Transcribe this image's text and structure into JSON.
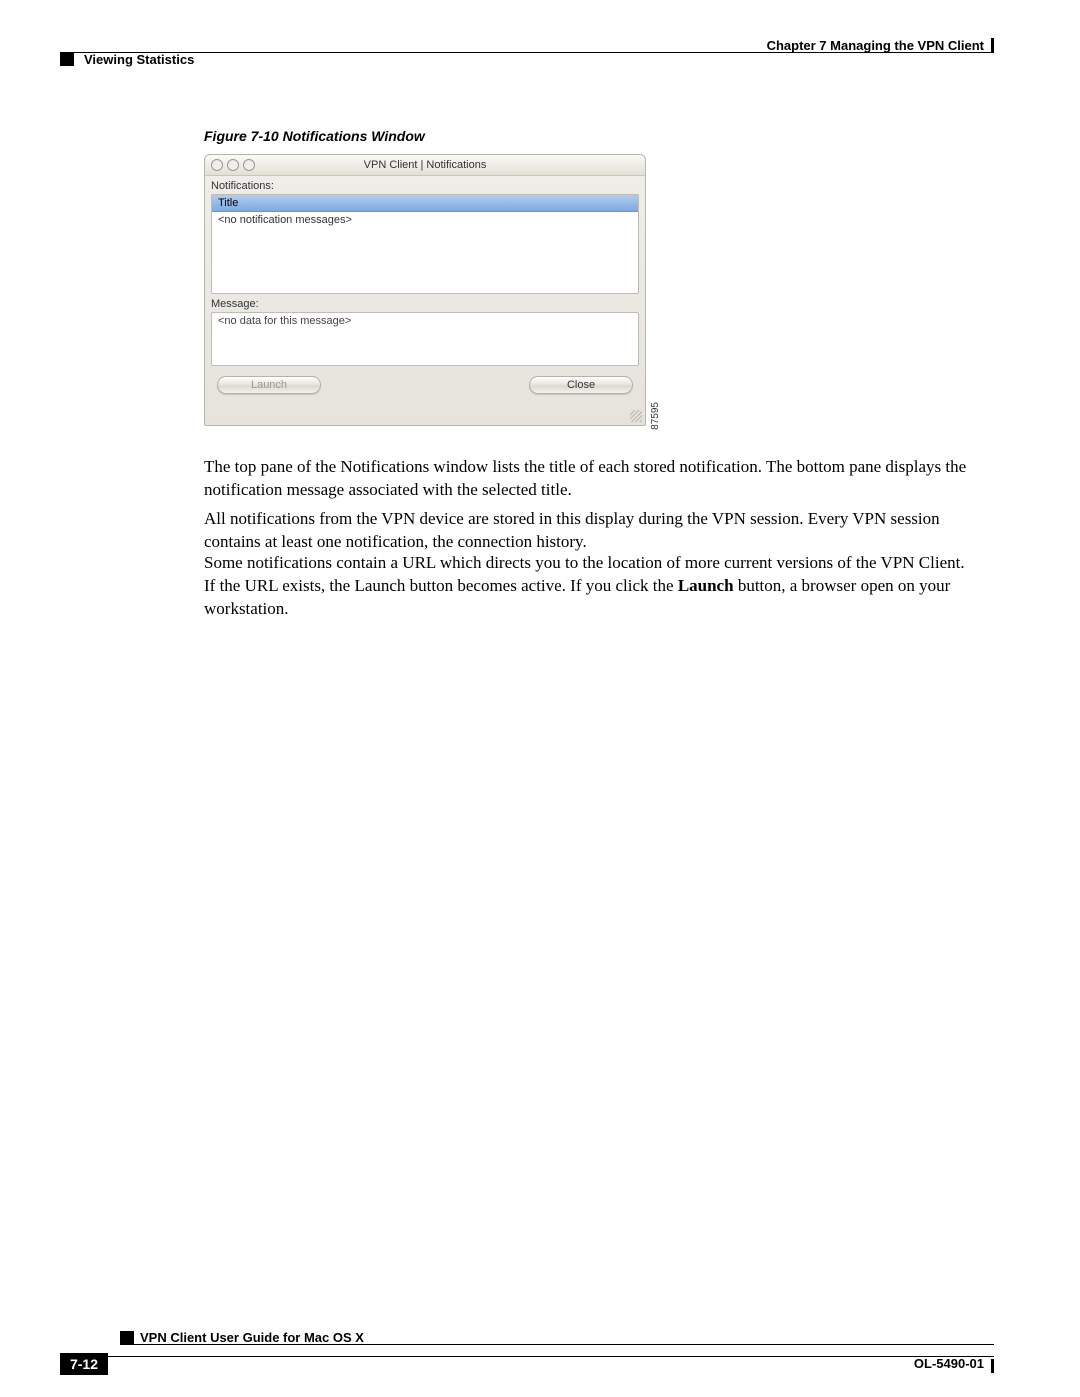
{
  "header": {
    "chapter": "Chapter 7    Managing the VPN Client",
    "section": "Viewing Statistics"
  },
  "figure": {
    "caption": "Figure 7-10    Notifications Window",
    "image_id": "87595",
    "window": {
      "title": "VPN Client  |  Notifications",
      "notifications_label": "Notifications:",
      "column_header": "Title",
      "empty_row": "<no notification messages>",
      "message_label": "Message:",
      "message_empty": "<no data for this message>",
      "launch_label": "Launch",
      "close_label": "Close"
    }
  },
  "body": {
    "p1": "The top pane of the Notifications window lists the title of each stored notification. The bottom pane displays the notification message associated with the selected title.",
    "p2": "All notifications from the VPN device are stored in this display during the VPN session. Every VPN session contains at least one notification, the connection history.",
    "p3_a": "Some notifications contain a URL which directs you to the location of more current versions of the VPN Client. If the URL exists, the Launch button becomes active. If you click the ",
    "p3_bold": "Launch",
    "p3_b": " button, a browser open on your workstation."
  },
  "footer": {
    "guide": "VPN Client User Guide for Mac OS X",
    "page": "7-12",
    "doc_id": "OL-5490-01"
  }
}
